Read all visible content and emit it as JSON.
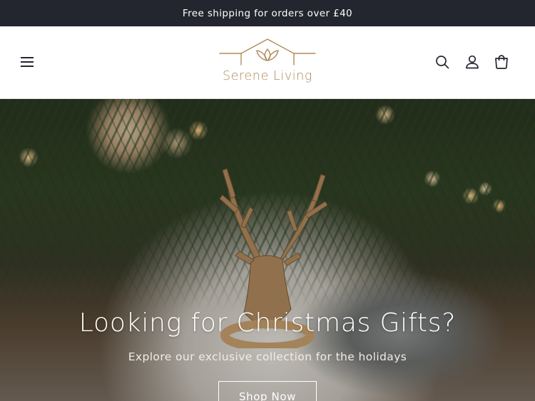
{
  "announcement": {
    "text": "Free shipping for orders over £40"
  },
  "header": {
    "logo_text": "Serene Living",
    "icons": [
      "menu-icon",
      "search-icon",
      "account-icon",
      "cart-icon"
    ],
    "brand_color": "#b08a5a"
  },
  "hero": {
    "title": "Looking for Christmas Gifts?",
    "subtitle": "Explore our exclusive collection for the holidays",
    "button_label": "Shop Now"
  },
  "colors": {
    "announcement_bg": "#23262f",
    "text_dark": "#23262f",
    "hero_text": "#ffffff"
  }
}
